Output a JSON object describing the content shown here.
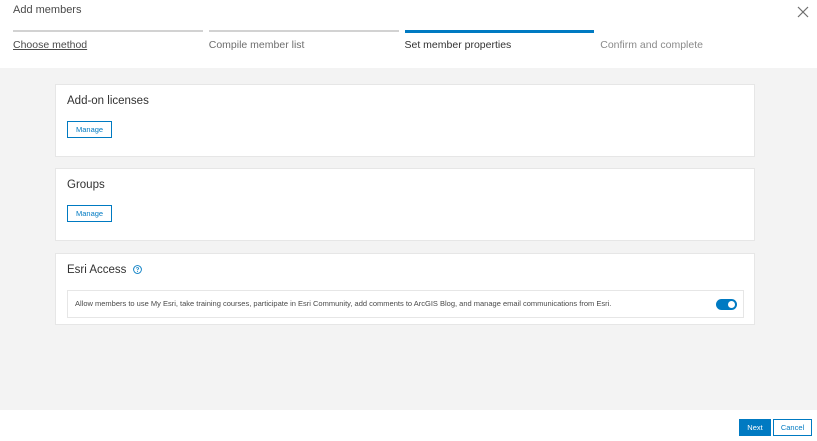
{
  "dialog": {
    "title": "Add members",
    "close_icon": "close-icon"
  },
  "steps": [
    {
      "label": "Choose method",
      "state": "done"
    },
    {
      "label": "Compile member list",
      "state": "done"
    },
    {
      "label": "Set member properties",
      "state": "active"
    },
    {
      "label": "Confirm and complete",
      "state": "upcoming"
    }
  ],
  "sections": {
    "addon_licenses": {
      "title": "Add-on licenses",
      "button_label": "Manage"
    },
    "groups": {
      "title": "Groups",
      "button_label": "Manage"
    },
    "esri_access": {
      "title": "Esri Access",
      "help_icon": "help-icon",
      "description": "Allow members to use My Esri, take training courses, participate in Esri Community, add comments to ArcGIS Blog, and manage email communications from Esri.",
      "toggle_on": true
    }
  },
  "footer": {
    "next_label": "Next",
    "cancel_label": "Cancel"
  },
  "colors": {
    "accent": "#007ac2",
    "background": "#f3f3f3"
  }
}
